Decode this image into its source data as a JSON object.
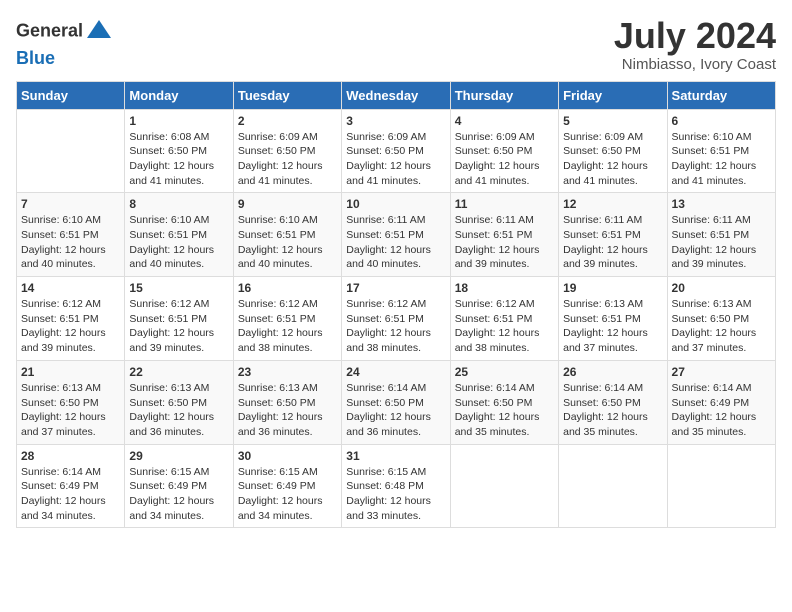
{
  "header": {
    "logo_general": "General",
    "logo_blue": "Blue",
    "month_title": "July 2024",
    "location": "Nimbiasso, Ivory Coast"
  },
  "days_of_week": [
    "Sunday",
    "Monday",
    "Tuesday",
    "Wednesday",
    "Thursday",
    "Friday",
    "Saturday"
  ],
  "weeks": [
    [
      {
        "day": "",
        "sunrise": "",
        "sunset": "",
        "daylight": ""
      },
      {
        "day": "1",
        "sunrise": "Sunrise: 6:08 AM",
        "sunset": "Sunset: 6:50 PM",
        "daylight": "Daylight: 12 hours and 41 minutes."
      },
      {
        "day": "2",
        "sunrise": "Sunrise: 6:09 AM",
        "sunset": "Sunset: 6:50 PM",
        "daylight": "Daylight: 12 hours and 41 minutes."
      },
      {
        "day": "3",
        "sunrise": "Sunrise: 6:09 AM",
        "sunset": "Sunset: 6:50 PM",
        "daylight": "Daylight: 12 hours and 41 minutes."
      },
      {
        "day": "4",
        "sunrise": "Sunrise: 6:09 AM",
        "sunset": "Sunset: 6:50 PM",
        "daylight": "Daylight: 12 hours and 41 minutes."
      },
      {
        "day": "5",
        "sunrise": "Sunrise: 6:09 AM",
        "sunset": "Sunset: 6:50 PM",
        "daylight": "Daylight: 12 hours and 41 minutes."
      },
      {
        "day": "6",
        "sunrise": "Sunrise: 6:10 AM",
        "sunset": "Sunset: 6:51 PM",
        "daylight": "Daylight: 12 hours and 41 minutes."
      }
    ],
    [
      {
        "day": "7",
        "sunrise": "Sunrise: 6:10 AM",
        "sunset": "Sunset: 6:51 PM",
        "daylight": "Daylight: 12 hours and 40 minutes."
      },
      {
        "day": "8",
        "sunrise": "Sunrise: 6:10 AM",
        "sunset": "Sunset: 6:51 PM",
        "daylight": "Daylight: 12 hours and 40 minutes."
      },
      {
        "day": "9",
        "sunrise": "Sunrise: 6:10 AM",
        "sunset": "Sunset: 6:51 PM",
        "daylight": "Daylight: 12 hours and 40 minutes."
      },
      {
        "day": "10",
        "sunrise": "Sunrise: 6:11 AM",
        "sunset": "Sunset: 6:51 PM",
        "daylight": "Daylight: 12 hours and 40 minutes."
      },
      {
        "day": "11",
        "sunrise": "Sunrise: 6:11 AM",
        "sunset": "Sunset: 6:51 PM",
        "daylight": "Daylight: 12 hours and 39 minutes."
      },
      {
        "day": "12",
        "sunrise": "Sunrise: 6:11 AM",
        "sunset": "Sunset: 6:51 PM",
        "daylight": "Daylight: 12 hours and 39 minutes."
      },
      {
        "day": "13",
        "sunrise": "Sunrise: 6:11 AM",
        "sunset": "Sunset: 6:51 PM",
        "daylight": "Daylight: 12 hours and 39 minutes."
      }
    ],
    [
      {
        "day": "14",
        "sunrise": "Sunrise: 6:12 AM",
        "sunset": "Sunset: 6:51 PM",
        "daylight": "Daylight: 12 hours and 39 minutes."
      },
      {
        "day": "15",
        "sunrise": "Sunrise: 6:12 AM",
        "sunset": "Sunset: 6:51 PM",
        "daylight": "Daylight: 12 hours and 39 minutes."
      },
      {
        "day": "16",
        "sunrise": "Sunrise: 6:12 AM",
        "sunset": "Sunset: 6:51 PM",
        "daylight": "Daylight: 12 hours and 38 minutes."
      },
      {
        "day": "17",
        "sunrise": "Sunrise: 6:12 AM",
        "sunset": "Sunset: 6:51 PM",
        "daylight": "Daylight: 12 hours and 38 minutes."
      },
      {
        "day": "18",
        "sunrise": "Sunrise: 6:12 AM",
        "sunset": "Sunset: 6:51 PM",
        "daylight": "Daylight: 12 hours and 38 minutes."
      },
      {
        "day": "19",
        "sunrise": "Sunrise: 6:13 AM",
        "sunset": "Sunset: 6:51 PM",
        "daylight": "Daylight: 12 hours and 37 minutes."
      },
      {
        "day": "20",
        "sunrise": "Sunrise: 6:13 AM",
        "sunset": "Sunset: 6:50 PM",
        "daylight": "Daylight: 12 hours and 37 minutes."
      }
    ],
    [
      {
        "day": "21",
        "sunrise": "Sunrise: 6:13 AM",
        "sunset": "Sunset: 6:50 PM",
        "daylight": "Daylight: 12 hours and 37 minutes."
      },
      {
        "day": "22",
        "sunrise": "Sunrise: 6:13 AM",
        "sunset": "Sunset: 6:50 PM",
        "daylight": "Daylight: 12 hours and 36 minutes."
      },
      {
        "day": "23",
        "sunrise": "Sunrise: 6:13 AM",
        "sunset": "Sunset: 6:50 PM",
        "daylight": "Daylight: 12 hours and 36 minutes."
      },
      {
        "day": "24",
        "sunrise": "Sunrise: 6:14 AM",
        "sunset": "Sunset: 6:50 PM",
        "daylight": "Daylight: 12 hours and 36 minutes."
      },
      {
        "day": "25",
        "sunrise": "Sunrise: 6:14 AM",
        "sunset": "Sunset: 6:50 PM",
        "daylight": "Daylight: 12 hours and 35 minutes."
      },
      {
        "day": "26",
        "sunrise": "Sunrise: 6:14 AM",
        "sunset": "Sunset: 6:50 PM",
        "daylight": "Daylight: 12 hours and 35 minutes."
      },
      {
        "day": "27",
        "sunrise": "Sunrise: 6:14 AM",
        "sunset": "Sunset: 6:49 PM",
        "daylight": "Daylight: 12 hours and 35 minutes."
      }
    ],
    [
      {
        "day": "28",
        "sunrise": "Sunrise: 6:14 AM",
        "sunset": "Sunset: 6:49 PM",
        "daylight": "Daylight: 12 hours and 34 minutes."
      },
      {
        "day": "29",
        "sunrise": "Sunrise: 6:15 AM",
        "sunset": "Sunset: 6:49 PM",
        "daylight": "Daylight: 12 hours and 34 minutes."
      },
      {
        "day": "30",
        "sunrise": "Sunrise: 6:15 AM",
        "sunset": "Sunset: 6:49 PM",
        "daylight": "Daylight: 12 hours and 34 minutes."
      },
      {
        "day": "31",
        "sunrise": "Sunrise: 6:15 AM",
        "sunset": "Sunset: 6:48 PM",
        "daylight": "Daylight: 12 hours and 33 minutes."
      },
      {
        "day": "",
        "sunrise": "",
        "sunset": "",
        "daylight": ""
      },
      {
        "day": "",
        "sunrise": "",
        "sunset": "",
        "daylight": ""
      },
      {
        "day": "",
        "sunrise": "",
        "sunset": "",
        "daylight": ""
      }
    ]
  ]
}
